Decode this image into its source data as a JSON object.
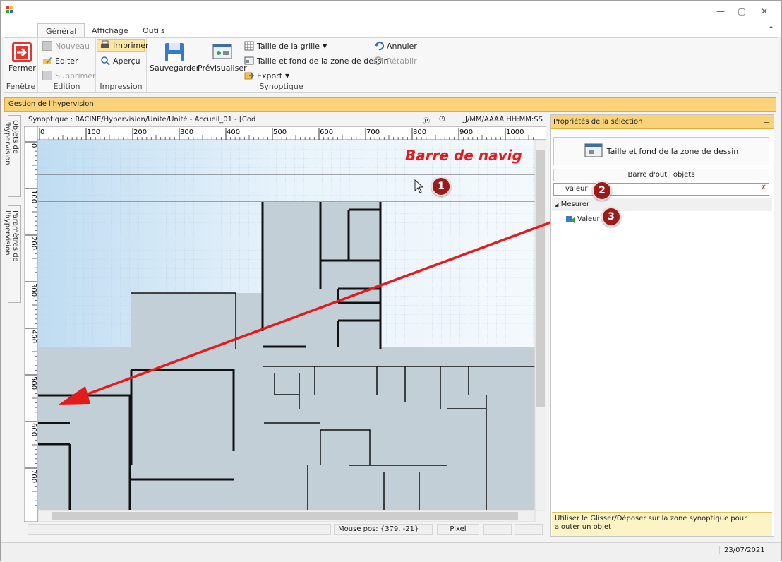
{
  "titlebar": {
    "minimize": "—",
    "maximize": "▢",
    "close": "✕",
    "collapse": "⌃"
  },
  "tabs": [
    "Général",
    "Affichage",
    "Outils"
  ],
  "ribbon": {
    "fenetre": {
      "close_label": "Fermer",
      "group": "Fenêtre"
    },
    "edition": {
      "new_label": "Nouveau",
      "edit_label": "Editer",
      "delete_label": "Supprimer",
      "group": "Edition"
    },
    "impression": {
      "print_label": "Imprimer",
      "preview_label": "Aperçu",
      "group": "Impression"
    },
    "synoptique": {
      "save_label": "Sauvegarder",
      "previsualize_label": "Prévisualiser",
      "grid_size_label": "Taille de la grille",
      "background_label": "Taille et fond de la zone de dessin",
      "export_label": "Export",
      "undo_label": "Annuler",
      "redo_label": "Rétablir",
      "group": "Synoptique"
    }
  },
  "panel_title": "Gestion de l'hypervision",
  "side_tabs": {
    "objects": "Objets de l'hypervision",
    "params": "Paramètres de l'hypervision"
  },
  "synoptic": {
    "path": "Synoptique : RACINE/Hypervision/Unité/Unité - Accueil_01 - [Cod",
    "p_icon": "Ⓟ",
    "clock_icon": "◷",
    "datetime": "JJ/MM/AAAA HH:MM:SS",
    "banner_text": "Barre de navig",
    "ruler_h": [
      "0",
      "100",
      "200",
      "300",
      "400",
      "500",
      "600",
      "700",
      "800",
      "900",
      "1000"
    ],
    "ruler_v": [
      "0",
      "100",
      "200",
      "300",
      "400",
      "500",
      "600",
      "700"
    ]
  },
  "status": {
    "mouse_pos": "Mouse pos: {379, -21}",
    "unit": "Pixel"
  },
  "props": {
    "title": "Propriétés de la sélection",
    "background_button": "Taille et fond de la zone de dessin",
    "toolbar_title": "Barre d'outil objets",
    "search_value": "valeur",
    "tree_group": "Mesurer",
    "tree_item": "Valeur",
    "hint": "Utiliser le Glisser/Déposer sur la zone synoptique pour ajouter un objet"
  },
  "footer_date": "23/07/2021",
  "badges": [
    "1",
    "2",
    "3"
  ],
  "colors": {
    "accent": "#f9d27a",
    "floor": "#c3cfd6",
    "canvas": "#e4f1fa",
    "arrow": "#e31b1b",
    "banner": "#e31b1b",
    "badge": "#9b1b1b"
  }
}
